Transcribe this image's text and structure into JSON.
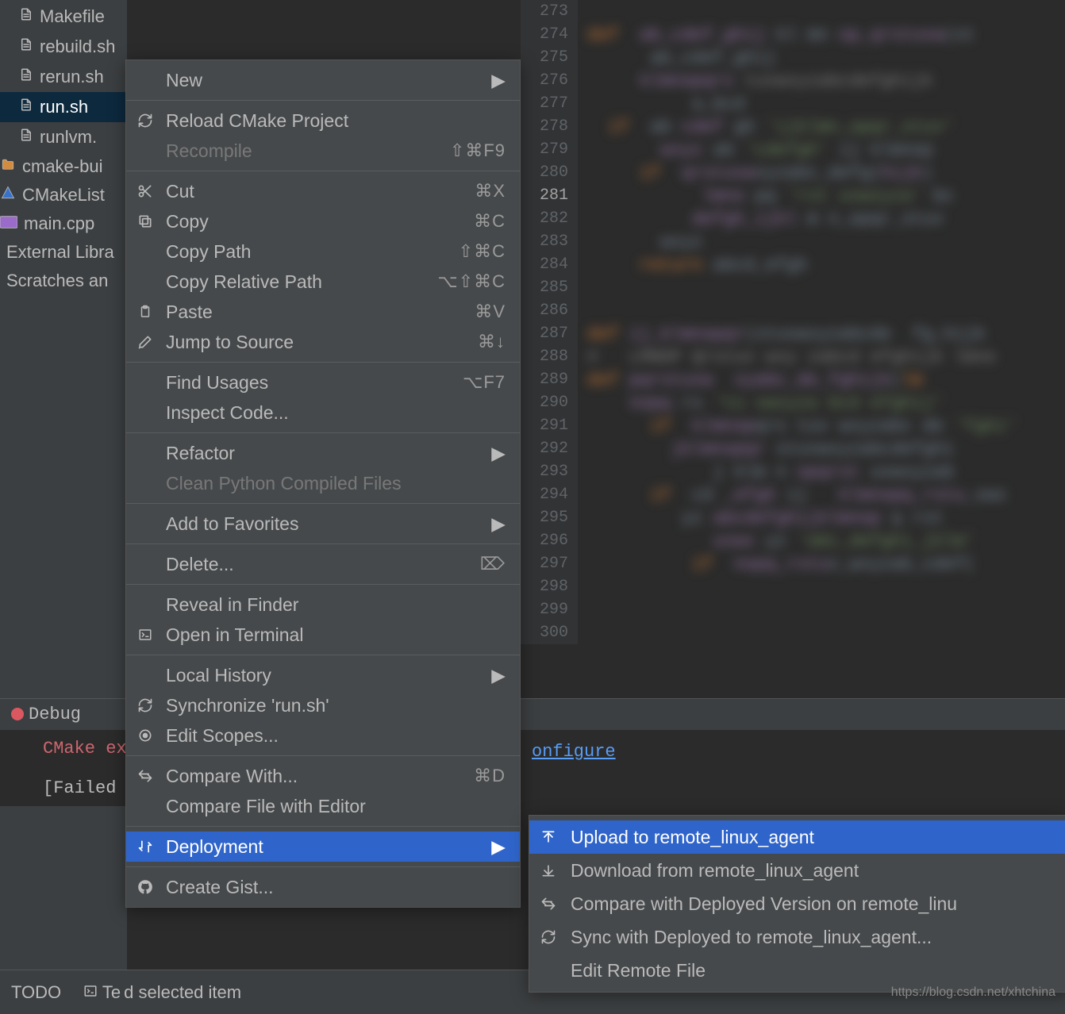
{
  "tree": {
    "items": [
      {
        "label": "Makefile",
        "icon": "file"
      },
      {
        "label": "rebuild.sh",
        "icon": "file"
      },
      {
        "label": "rerun.sh",
        "icon": "file"
      },
      {
        "label": "run.sh",
        "icon": "file",
        "selected": true
      },
      {
        "label": "runlvm.",
        "icon": "file"
      },
      {
        "label": "cmake-bui",
        "icon": "folder",
        "less": true
      },
      {
        "label": "CMakeList",
        "icon": "cmake",
        "less": true
      },
      {
        "label": "main.cpp",
        "icon": "cpp",
        "less": true
      },
      {
        "label": "External Libra",
        "icon": "",
        "less": true
      },
      {
        "label": "Scratches an",
        "icon": "",
        "less": true
      }
    ]
  },
  "gutter": {
    "start": 273,
    "end": 300,
    "highlight": 281
  },
  "menu": {
    "items": [
      {
        "label": "New",
        "arrow": true
      },
      {
        "sep": true
      },
      {
        "label": "Reload CMake Project",
        "icon": "reload"
      },
      {
        "label": "Recompile",
        "shortcut": "⇧⌘F9",
        "disabled": true
      },
      {
        "sep": true
      },
      {
        "label": "Cut",
        "icon": "cut",
        "shortcut": "⌘X"
      },
      {
        "label": "Copy",
        "icon": "copy",
        "shortcut": "⌘C"
      },
      {
        "label": "Copy Path",
        "shortcut": "⇧⌘C"
      },
      {
        "label": "Copy Relative Path",
        "shortcut": "⌥⇧⌘C"
      },
      {
        "label": "Paste",
        "icon": "paste",
        "shortcut": "⌘V"
      },
      {
        "label": "Jump to Source",
        "icon": "edit",
        "shortcut": "⌘↓"
      },
      {
        "sep": true
      },
      {
        "label": "Find Usages",
        "shortcut": "⌥F7"
      },
      {
        "label": "Inspect Code..."
      },
      {
        "sep": true
      },
      {
        "label": "Refactor",
        "arrow": true
      },
      {
        "label": "Clean Python Compiled Files",
        "disabled": true
      },
      {
        "sep": true
      },
      {
        "label": "Add to Favorites",
        "arrow": true
      },
      {
        "sep": true
      },
      {
        "label": "Delete...",
        "shortcut": "⌦"
      },
      {
        "sep": true
      },
      {
        "label": "Reveal in Finder"
      },
      {
        "label": "Open in Terminal",
        "icon": "terminal"
      },
      {
        "sep": true
      },
      {
        "label": "Local History",
        "arrow": true
      },
      {
        "label": "Synchronize 'run.sh'",
        "icon": "reload"
      },
      {
        "label": "Edit Scopes...",
        "icon": "scope"
      },
      {
        "sep": true
      },
      {
        "label": "Compare With...",
        "icon": "compare",
        "shortcut": "⌘D"
      },
      {
        "label": "Compare File with Editor"
      },
      {
        "sep": true
      },
      {
        "label": "Deployment",
        "icon": "deploy",
        "arrow": true,
        "selected": true
      },
      {
        "sep": true
      },
      {
        "label": "Create Gist...",
        "icon": "github"
      }
    ]
  },
  "submenu": {
    "items": [
      {
        "label": "Upload to remote_linux_agent",
        "icon": "upload",
        "selected": true
      },
      {
        "label": "Download from remote_linux_agent",
        "icon": "download"
      },
      {
        "label": "Compare with Deployed Version on remote_linu",
        "icon": "compare"
      },
      {
        "label": "Sync with Deployed to remote_linux_agent...",
        "icon": "reload"
      },
      {
        "label": "Edit Remote File"
      }
    ]
  },
  "bottom": {
    "tab": "Debug",
    "line1": "CMake ex",
    "line2": "[Failed",
    "configure": "onfigure"
  },
  "status": {
    "todo": "TODO",
    "te": "Te",
    "msg": "d selected item"
  },
  "watermark": "https://blog.csdn.net/xhtchina"
}
